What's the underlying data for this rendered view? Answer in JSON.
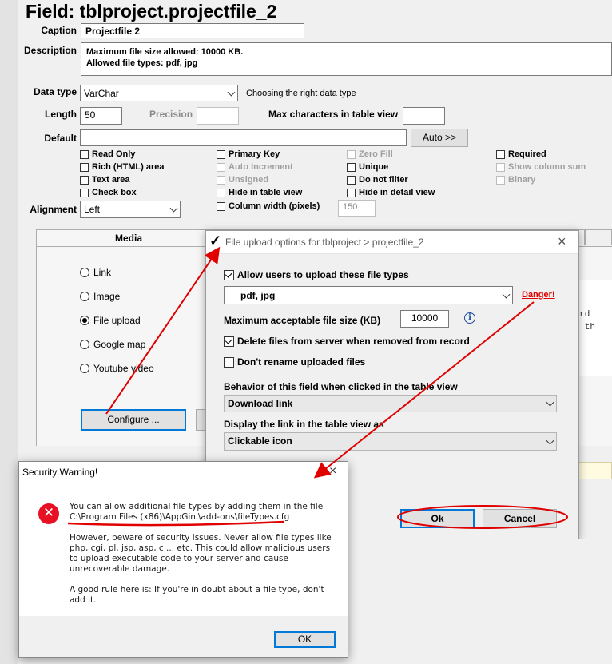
{
  "field_title": "Field: tblproject.projectfile_2",
  "caption": {
    "label": "Caption",
    "value": "Projectfile 2"
  },
  "description": {
    "label": "Description",
    "line1": "Maximum file size allowed: 10000 KB.",
    "line2": "Allowed file types: pdf, jpg"
  },
  "data_type": {
    "label": "Data type",
    "value": "VarChar",
    "help_link": "Choosing the right data type"
  },
  "length": {
    "label": "Length",
    "value": "50"
  },
  "precision": {
    "label": "Precision",
    "value": ""
  },
  "max_chars": {
    "label": "Max characters in table view",
    "value": ""
  },
  "default": {
    "label": "Default",
    "value": "",
    "auto_button": "Auto >>"
  },
  "checkboxes": {
    "read_only": "Read Only",
    "rich_html": "Rich (HTML) area",
    "text_area": "Text area",
    "check_box": "Check box",
    "primary_key": "Primary Key",
    "auto_increment": "Auto Increment",
    "unsigned": "Unsigned",
    "hide_table_view": "Hide in table view",
    "column_width": "Column width (pixels)",
    "zero_fill": "Zero Fill",
    "unique": "Unique",
    "do_not_filter": "Do not filter",
    "hide_detail_view": "Hide in detail view",
    "required": "Required",
    "show_column_sum": "Show column sum",
    "binary": "Binary"
  },
  "column_width_value": "150",
  "alignment": {
    "label": "Alignment",
    "value": "Left"
  },
  "media_tab": {
    "label": "Media",
    "options": [
      "Link",
      "Image",
      "File upload",
      "Google map",
      "Youtube video"
    ],
    "selected": "File upload",
    "configure_button": "Configure ..."
  },
  "bg_text": {
    "line1": "cord i",
    "line2": "on th"
  },
  "upload_dialog": {
    "title": "File upload options for tblproject > projectfile_2",
    "check_mark": "✓",
    "allow_label": "Allow users to upload these file types",
    "file_types": "pdf, jpg",
    "danger_link": "Danger!",
    "max_size_label": "Maximum acceptable file size (KB)",
    "max_size_value": "10000",
    "info_icon": "info-icon",
    "delete_label": "Delete files from server when removed from record",
    "rename_label": "Don't rename uploaded files",
    "behavior_label": "Behavior of this field when clicked in the table view",
    "behavior_value": "Download link",
    "display_label": "Display the link in the table view as",
    "display_value": "Clickable icon",
    "ok": "Ok",
    "cancel": "Cancel"
  },
  "security_dialog": {
    "title": "Security Warning!",
    "line1": "You can allow additional file types by adding them in the file",
    "path": "C:\\Program Files (x86)\\AppGini\\add-ons\\fileTypes.cfg",
    "para2": [
      "However, beware of security issues. Never allow file types like",
      "php, cgi, pl, jsp, asp, c ... etc. This could allow malicious users",
      "to upload executable code to your server and cause",
      "unrecoverable damage."
    ],
    "para3": [
      "A good rule here is: If you're in doubt about a file type, don't",
      "add it."
    ],
    "ok": "OK"
  },
  "annotation_color": "#e00000"
}
